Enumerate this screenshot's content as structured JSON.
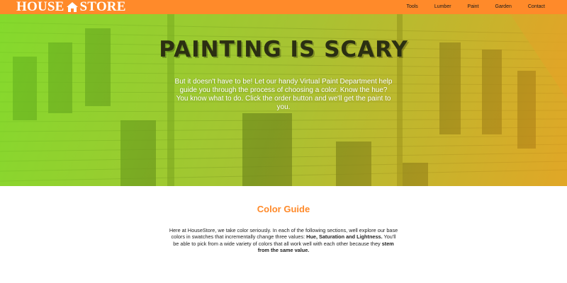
{
  "header": {
    "logo_left": "HOUSE",
    "logo_right": "STORE",
    "logo_icon": "house-icon",
    "nav": [
      "Tools",
      "Lumber",
      "Paint",
      "Garden",
      "Contact"
    ]
  },
  "hero": {
    "title": "PAINTING IS SCARY",
    "text": "But it doesn't have to be! Let our handy Virtual Paint Department help guide you through the process of choosing a color. Know the hue? You know what to do. Click the order button and we'll get the paint to you."
  },
  "guide": {
    "title": "Color Guide",
    "text_1": "Here at HouseStore, we take color seriously. In each of the following sections, well explore our base colors in swatches that incrementally change three values: ",
    "bold_1": "Hue, Saturation and Lightness.",
    "text_2": " You'll be able to pick from a wide variety of colors that all work well with each other because they ",
    "bold_2": "stem from the same value."
  },
  "colors": {
    "accent": "#ff8a2a",
    "nav_text": "#1a1a1a",
    "hero_green": "#7bd927",
    "hero_orange": "#f0a02a"
  }
}
